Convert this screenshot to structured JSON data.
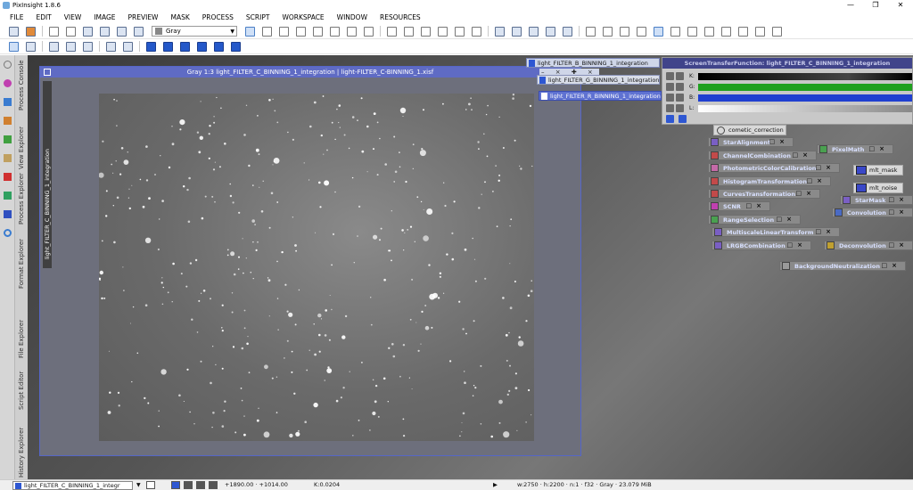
{
  "window": {
    "title": "PixInsight 1.8.6",
    "controls": [
      "—",
      "❐",
      "✕"
    ]
  },
  "menu": [
    "FILE",
    "EDIT",
    "VIEW",
    "IMAGE",
    "PREVIEW",
    "MASK",
    "PROCESS",
    "SCRIPT",
    "WORKSPACE",
    "WINDOW",
    "RESOURCES"
  ],
  "toolbar": {
    "color_space": "Gray"
  },
  "left_panel_labels": [
    "Process Console",
    "View Explorer",
    "Process Explorer",
    "Format Explorer",
    "File Explorer",
    "Script Editor",
    "History Explorer"
  ],
  "image_window": {
    "title": "Gray 1:3 light_FILTER_C_BINNING_1_integration | light-FILTER_C-BINNING_1.xisf",
    "vertical_tab": "light_FILTER_C_BINNING_1_integration"
  },
  "mini_windows": [
    {
      "label": "light_FILTER_B_BINNING_1_integration"
    },
    {
      "label": "light_FILTER_G_BINNING_1_integration"
    },
    {
      "label": "light_FILTER_R_BINNING_1_integration"
    }
  ],
  "mini_buttons": "– × ✚ ×",
  "stf": {
    "title": "ScreenTransferFunction: light_FILTER_C_BINNING_1_integration",
    "channels": [
      "K:",
      "G:",
      "B:",
      "L:"
    ],
    "channel_colors": [
      "#000000",
      "#1fa01f",
      "#1f3fd0",
      "#888888"
    ]
  },
  "process_icons": [
    {
      "label": "cometic_correction",
      "style": "light"
    },
    {
      "label": "StarAlignment",
      "style": "proc"
    },
    {
      "label": "PixelMath",
      "style": "proc"
    },
    {
      "label": "ChannelCombination",
      "style": "proc"
    },
    {
      "label": "PhotometricColorCalibration",
      "style": "proc"
    },
    {
      "label": "mlt_mask",
      "style": "mask"
    },
    {
      "label": "HistogramTransformation",
      "style": "proc"
    },
    {
      "label": "mlt_noise",
      "style": "mask"
    },
    {
      "label": "CurvesTransformation",
      "style": "proc"
    },
    {
      "label": "StarMask",
      "style": "proc"
    },
    {
      "label": "SCNR",
      "style": "proc"
    },
    {
      "label": "Convolution",
      "style": "proc"
    },
    {
      "label": "RangeSelection",
      "style": "proc"
    },
    {
      "label": "MultiscaleLinearTransform",
      "style": "proc"
    },
    {
      "label": "LRGBCombination",
      "style": "proc"
    },
    {
      "label": "Deconvolution",
      "style": "proc"
    },
    {
      "label": "BackgroundNeutralization",
      "style": "proc"
    }
  ],
  "statusbar": {
    "view_select": "light_FILTER_C_BINNING_1_integr",
    "cursor": "+1890.00 · +1014.00",
    "value": "K:0.0204",
    "info": "w:2750 · h:2200 · n:1 · f32 · Gray · 23.079 MiB"
  }
}
